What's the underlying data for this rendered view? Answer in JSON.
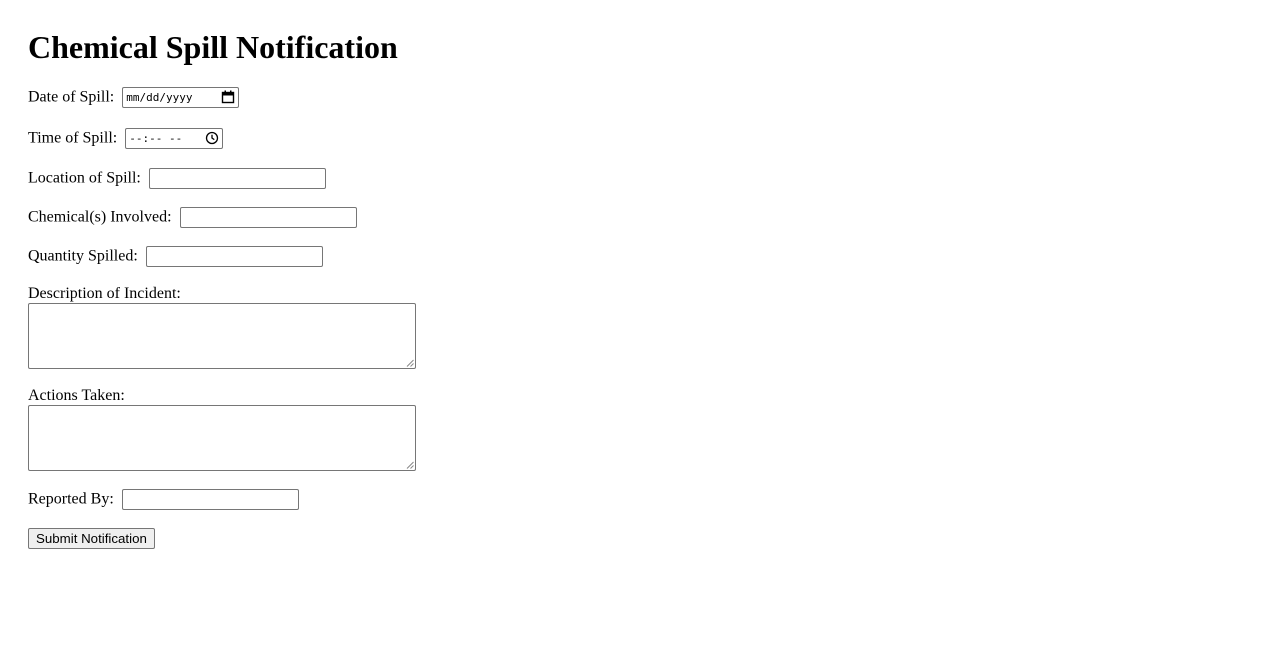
{
  "form": {
    "title": "Chemical Spill Notification",
    "date_label": "Date of Spill:",
    "date_placeholder": "mm/dd/yyyy",
    "time_label": "Time of Spill:",
    "time_placeholder": "--:-- --",
    "location_label": "Location of Spill:",
    "location_value": "",
    "chemicals_label": "Chemical(s) Involved:",
    "chemicals_value": "",
    "quantity_label": "Quantity Spilled:",
    "quantity_value": "",
    "description_label": "Description of Incident:",
    "description_value": "",
    "actions_label": "Actions Taken:",
    "actions_value": "",
    "reported_by_label": "Reported By:",
    "reported_by_value": "",
    "submit_label": "Submit Notification"
  },
  "icons": {
    "date_picker": "calendar-icon",
    "time_picker": "clock-icon",
    "resize": "resize-grip-icon"
  },
  "colors": {
    "field_border": "#767676",
    "button_background": "#efefef"
  }
}
